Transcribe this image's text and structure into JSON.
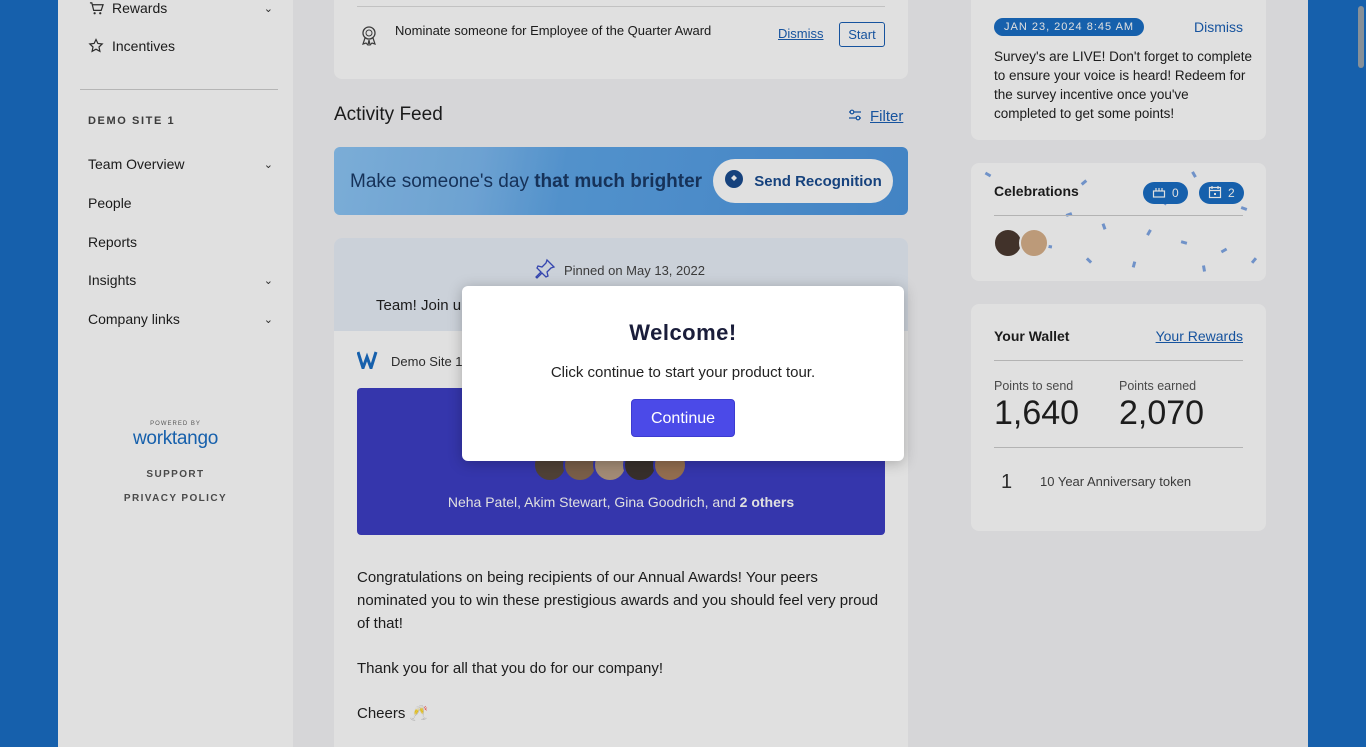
{
  "sidebar": {
    "top_items": [
      {
        "label": "Rewards",
        "icon": "cart-icon",
        "has_chevron": true
      },
      {
        "label": "Incentives",
        "icon": "star-icon",
        "has_chevron": false
      }
    ],
    "section_title": "DEMO SITE 1",
    "items": [
      {
        "label": "Team Overview",
        "has_chevron": true
      },
      {
        "label": "People",
        "has_chevron": false
      },
      {
        "label": "Reports",
        "has_chevron": false
      },
      {
        "label": "Insights",
        "has_chevron": true
      },
      {
        "label": "Company links",
        "has_chevron": true
      }
    ],
    "powered_by": "POWERED BY",
    "logo_text": "worktango",
    "support": "SUPPORT",
    "privacy": "PRIVACY POLICY"
  },
  "nominate": {
    "text": "Nominate someone for Employee of the Quarter Award",
    "dismiss": "Dismiss",
    "start": "Start"
  },
  "feed": {
    "title": "Activity Feed",
    "filter": "Filter",
    "banner_text": "Make someone's day ",
    "banner_bold": "that much brighter",
    "send_button": "Send Recognition"
  },
  "post": {
    "pinned": "Pinned on May 13, 2022",
    "team_join": "Team! Join u",
    "site": "Demo Site 1",
    "names": "Neha Patel, Akim Stewart, Gina Goodrich, and ",
    "others": "2 others",
    "para1": "Congratulations on being recipients of our Annual Awards! Your peers nominated you to win these prestigious awards and you should feel very proud of that!",
    "para2": "Thank you for all that you do for our company!",
    "para3": "Cheers 🥂"
  },
  "survey": {
    "date": "JAN 23, 2024 8:45 AM",
    "dismiss": "Dismiss",
    "message": "Survey's are LIVE! Don't forget to complete to ensure your voice is heard! Redeem for the survey incentive once you've completed to get some points!"
  },
  "celebrations": {
    "title": "Celebrations",
    "birthday_count": "0",
    "anniversary_count": "2"
  },
  "wallet": {
    "title": "Your Wallet",
    "rewards_link": "Your Rewards",
    "points_to_send_label": "Points to send",
    "points_to_send": "1,640",
    "points_earned_label": "Points earned",
    "points_earned": "2,070",
    "token_count": "1",
    "token_label": "10 Year Anniversary token"
  },
  "modal": {
    "title": "Welcome!",
    "message": "Click continue to start your product tour.",
    "continue": "Continue"
  },
  "colors": {
    "brand_blue": "#1a6ec4",
    "link_blue": "#1a5fb4",
    "purple": "#3d3ec4",
    "modal_button": "#4b4ae8"
  }
}
